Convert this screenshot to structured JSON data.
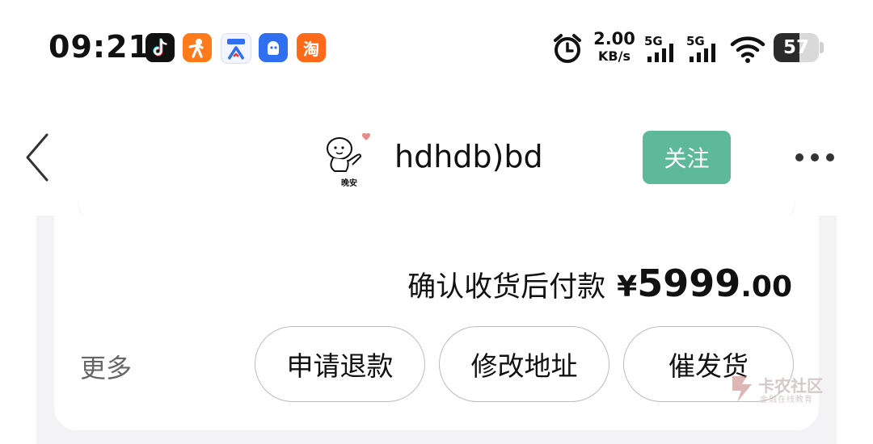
{
  "status_bar": {
    "time": "09:21",
    "apps": [
      "douyin-icon",
      "dianping-icon",
      "dongchedi-icon",
      "qq-icon",
      "taobao-icon"
    ],
    "taobao_glyph": "淘",
    "network_speed_value": "2.00",
    "network_speed_unit": "KB/s",
    "signal_1_label": "5G",
    "signal_2_label": "5G",
    "battery_percent": "57",
    "battery_level": 0.57
  },
  "nav": {
    "title": "hdhdb)bd",
    "avatar_caption": "晚安",
    "follow_label": "关注"
  },
  "order": {
    "payment_note": "确认收货后付款",
    "currency": "¥",
    "price_integer": "5999",
    "price_decimal": ".00",
    "more_label": "更多",
    "buttons": {
      "refund": "申请退款",
      "change_address": "修改地址",
      "urge_shipping": "催发货"
    }
  },
  "watermark": {
    "name": "卡农社区",
    "subtitle": "金融在线教育"
  },
  "colors": {
    "follow_bg": "#5db99a",
    "page_bg": "#f3f3f5"
  }
}
